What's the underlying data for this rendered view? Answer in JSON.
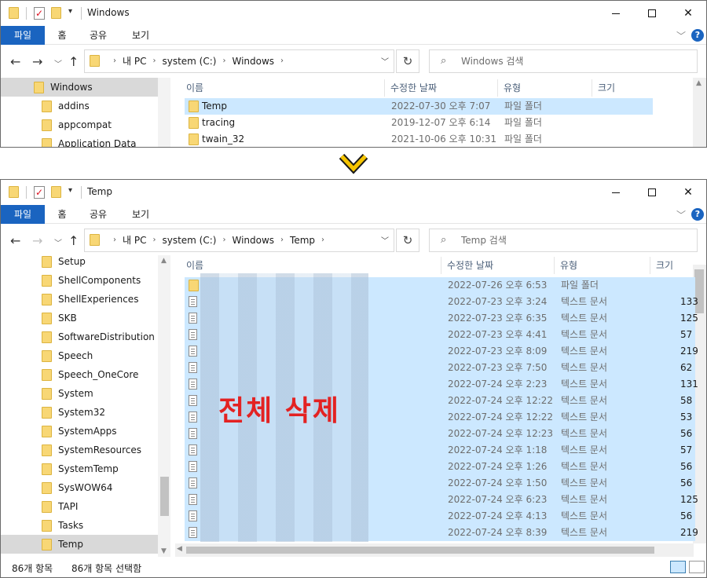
{
  "top": {
    "title": "Windows",
    "ribbon_tabs": [
      "파일",
      "홈",
      "공유",
      "보기"
    ],
    "crumbs": [
      "내 PC",
      "system (C:)",
      "Windows"
    ],
    "search_placeholder": "Windows 검색",
    "nav": [
      "Windows",
      "addins",
      "appcompat",
      "Application Data"
    ],
    "headers": {
      "name": "이름",
      "date": "수정한 날짜",
      "type": "유형",
      "size": "크기"
    },
    "rows": [
      {
        "name": "Temp",
        "date": "2022-07-30 오후 7:07",
        "type": "파일 폴더"
      },
      {
        "name": "tracing",
        "date": "2019-12-07 오후 6:14",
        "type": "파일 폴더"
      },
      {
        "name": "twain_32",
        "date": "2021-10-06 오후 10:31",
        "type": "파일 폴더"
      }
    ]
  },
  "bottom": {
    "title": "Temp",
    "ribbon_tabs": [
      "파일",
      "홈",
      "공유",
      "보기"
    ],
    "crumbs": [
      "내 PC",
      "system (C:)",
      "Windows",
      "Temp"
    ],
    "search_placeholder": "Temp 검색",
    "nav": [
      "Setup",
      "ShellComponents",
      "ShellExperiences",
      "SKB",
      "SoftwareDistribution",
      "Speech",
      "Speech_OneCore",
      "System",
      "System32",
      "SystemApps",
      "SystemResources",
      "SystemTemp",
      "SysWOW64",
      "TAPI",
      "Tasks",
      "Temp"
    ],
    "headers": {
      "name": "이름",
      "date": "수정한 날짜",
      "type": "유형",
      "size": "크기"
    },
    "rows": [
      {
        "kind": "folder",
        "date": "2022-07-26 오후 6:53",
        "type": "파일 폴더",
        "size": ""
      },
      {
        "kind": "doc",
        "date": "2022-07-23 오후 3:24",
        "type": "텍스트 문서",
        "size": "133"
      },
      {
        "kind": "doc",
        "date": "2022-07-23 오후 6:35",
        "type": "텍스트 문서",
        "size": "125"
      },
      {
        "kind": "doc",
        "date": "2022-07-23 오후 4:41",
        "type": "텍스트 문서",
        "size": "57"
      },
      {
        "kind": "doc",
        "date": "2022-07-23 오후 8:09",
        "type": "텍스트 문서",
        "size": "219"
      },
      {
        "kind": "doc",
        "date": "2022-07-23 오후 7:50",
        "type": "텍스트 문서",
        "size": "62"
      },
      {
        "kind": "doc",
        "date": "2022-07-24 오후 2:23",
        "type": "텍스트 문서",
        "size": "131"
      },
      {
        "kind": "doc",
        "date": "2022-07-24 오후 12:22",
        "type": "텍스트 문서",
        "size": "58"
      },
      {
        "kind": "doc",
        "date": "2022-07-24 오후 12:22",
        "type": "텍스트 문서",
        "size": "53"
      },
      {
        "kind": "doc",
        "date": "2022-07-24 오후 12:23",
        "type": "텍스트 문서",
        "size": "56"
      },
      {
        "kind": "doc",
        "date": "2022-07-24 오후 1:18",
        "type": "텍스트 문서",
        "size": "57"
      },
      {
        "kind": "doc",
        "date": "2022-07-24 오후 1:26",
        "type": "텍스트 문서",
        "size": "56"
      },
      {
        "kind": "doc",
        "date": "2022-07-24 오후 1:50",
        "type": "텍스트 문서",
        "size": "56"
      },
      {
        "kind": "doc",
        "date": "2022-07-24 오후 6:23",
        "type": "텍스트 문서",
        "size": "125"
      },
      {
        "kind": "doc",
        "date": "2022-07-24 오후 4:13",
        "type": "텍스트 문서",
        "size": "56"
      },
      {
        "kind": "doc",
        "date": "2022-07-24 오후 8:39",
        "type": "텍스트 문서",
        "size": "219"
      }
    ],
    "status_items": "86개 항목",
    "status_selected": "86개 항목 선택함"
  },
  "annotation": "전체 삭제",
  "colors": {
    "accent": "#1a64c0",
    "selection": "#cce8ff",
    "annotation": "#e32222",
    "arrow": "#f5c400"
  }
}
